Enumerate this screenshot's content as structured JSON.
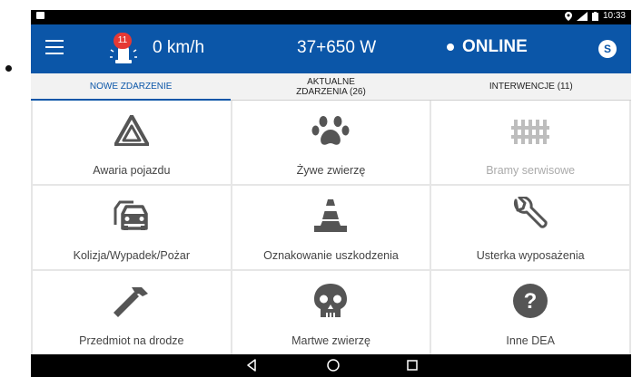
{
  "status_bar": {
    "time": "10:33"
  },
  "app_bar": {
    "alert_count": "11",
    "speed": "0 km/h",
    "location": "37+650 W",
    "status": "ONLINE",
    "user_initial": "S"
  },
  "tabs": [
    {
      "label": "NOWE ZDARZENIE",
      "active": true
    },
    {
      "label": "AKTUALNE ZDARZENIA (26)",
      "active": false
    },
    {
      "label": "INTERWENCJE (11)",
      "active": false
    }
  ],
  "tiles": [
    {
      "label": "Awaria pojazdu",
      "icon": "warning-triangle-icon"
    },
    {
      "label": "Żywe zwierzę",
      "icon": "paw-icon"
    },
    {
      "label": "Bramy serwisowe",
      "icon": "fence-icon",
      "disabled": true
    },
    {
      "label": "Kolizja/Wypadek/Pożar",
      "icon": "car-crash-icon"
    },
    {
      "label": "Oznakowanie uszkodzenia",
      "icon": "traffic-cone-icon"
    },
    {
      "label": "Usterka wyposażenia",
      "icon": "wrench-icon"
    },
    {
      "label": "Przedmiot na drodze",
      "icon": "hammer-icon"
    },
    {
      "label": "Martwe zwierzę",
      "icon": "skull-icon"
    },
    {
      "label": "Inne DEA",
      "icon": "question-icon"
    }
  ],
  "colors": {
    "primary": "#0b56a8",
    "badge": "#e53935",
    "icon": "#555555",
    "icon_disabled": "#bdbdbd"
  }
}
